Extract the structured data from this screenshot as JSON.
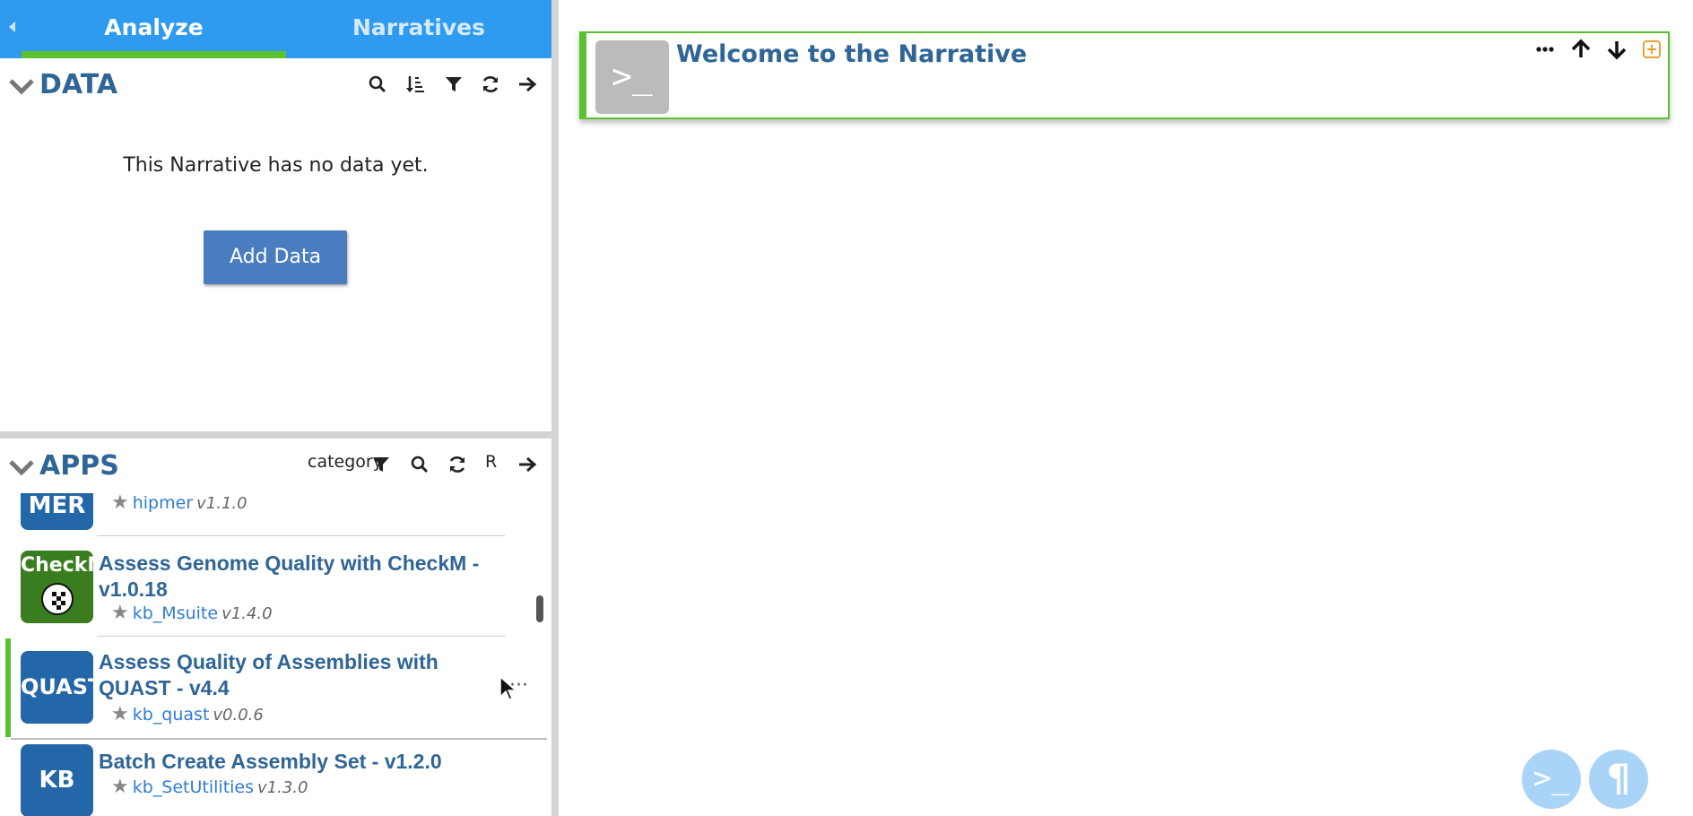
{
  "tabs": {
    "analyze": "Analyze",
    "narratives": "Narratives"
  },
  "data_panel": {
    "title": "DATA",
    "empty_message": "This Narrative has no data yet.",
    "add_button": "Add Data",
    "toolbar_icons": [
      "search-icon",
      "sort-icon",
      "filter-icon",
      "refresh-icon",
      "arrow-right-icon"
    ]
  },
  "apps_panel": {
    "title": "APPS",
    "category_label": "category",
    "r_label": "R",
    "toolbar_icons": [
      "filter-icon",
      "search-icon",
      "refresh-icon",
      "arrow-right-icon"
    ],
    "apps": [
      {
        "logo": "MER",
        "name": "",
        "module": "hipmer",
        "version": "v1.1.0",
        "logo_color": "#2467a8"
      },
      {
        "logo": "CheckM",
        "name": "Assess Genome Quality with CheckM - v1.0.18",
        "module": "kb_Msuite",
        "version": "v1.4.0",
        "logo_color": "#3a7d1f"
      },
      {
        "logo": "QUAST",
        "name": "Assess Quality of Assemblies with QUAST - v4.4",
        "module": "kb_quast",
        "version": "v0.0.6",
        "logo_color": "#2467a8"
      },
      {
        "logo": "KB",
        "name": "Batch Create Assembly Set - v1.2.0",
        "module": "kb_SetUtilities",
        "version": "v1.3.0",
        "logo_color": "#2467a8"
      }
    ]
  },
  "narrative": {
    "cell_title": "Welcome to the Narrative",
    "cell_icon": ">_",
    "cell_tools": [
      "more-options-icon",
      "move-up-icon",
      "move-down-icon",
      "add-cell-icon"
    ]
  },
  "fabs": {
    "code": ">_",
    "markdown": "¶"
  },
  "colors": {
    "tab_blue": "#2e9bf0",
    "accent_green": "#5ac22e",
    "title_blue": "#2f6597",
    "button_blue": "#4a7dbf",
    "link_blue": "#2f7bd4"
  }
}
